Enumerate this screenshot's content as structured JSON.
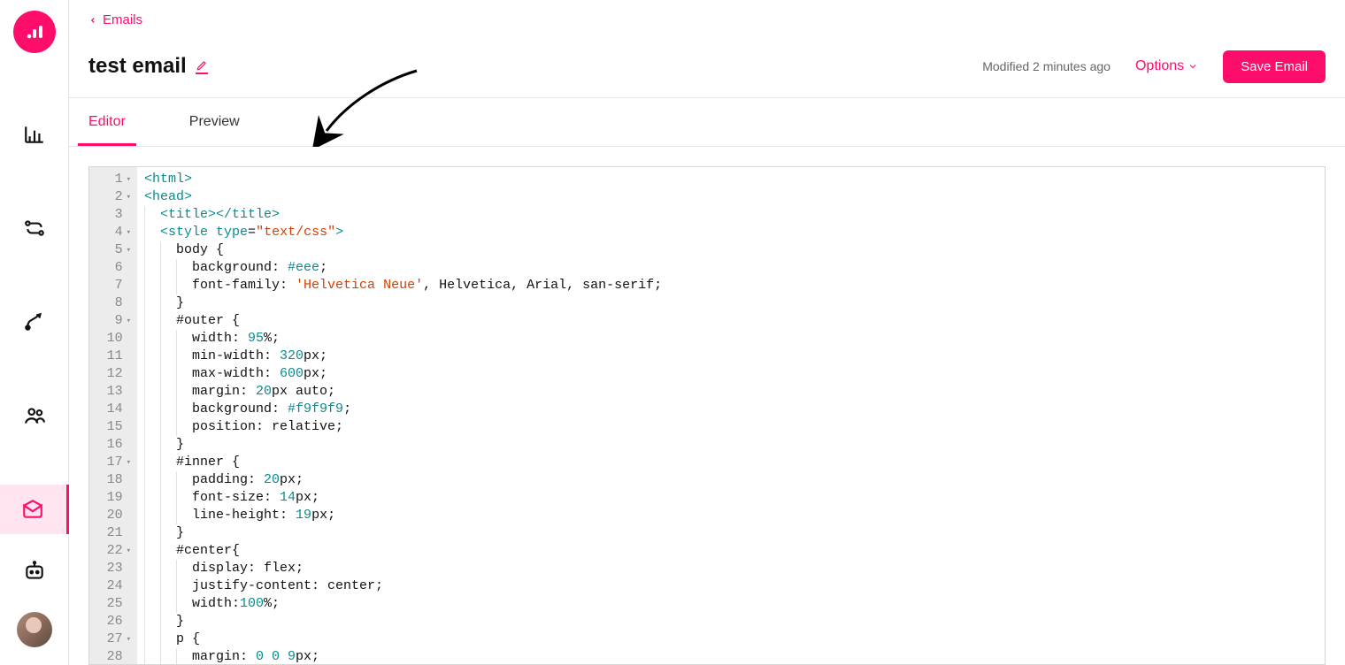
{
  "sidebar": {
    "nav_items": [
      {
        "name": "analytics",
        "icon": "bar-chart-icon"
      },
      {
        "name": "flows",
        "icon": "flow-icon"
      },
      {
        "name": "journeys",
        "icon": "journey-icon"
      },
      {
        "name": "people",
        "icon": "people-icon"
      },
      {
        "name": "emails",
        "icon": "envelope-icon",
        "active": true
      }
    ]
  },
  "header": {
    "back_label": "Emails",
    "title": "test email",
    "modified_text": "Modified 2 minutes ago",
    "options_label": "Options",
    "save_label": "Save Email"
  },
  "tabs": {
    "editor_label": "Editor",
    "preview_label": "Preview"
  },
  "editor": {
    "lines": [
      {
        "n": 1,
        "fold": true,
        "html": "<span class='tag'>&lt;html&gt;</span>"
      },
      {
        "n": 2,
        "fold": true,
        "html": "<span class='tag'>&lt;head&gt;</span>"
      },
      {
        "n": 3,
        "fold": false,
        "html": "  <span class='tag'>&lt;title&gt;&lt;/title&gt;</span>"
      },
      {
        "n": 4,
        "fold": true,
        "html": "  <span class='tag'>&lt;style</span> <span class='attr'>type</span>=<span class='str'>\"text/css\"</span><span class='tag'>&gt;</span>"
      },
      {
        "n": 5,
        "fold": true,
        "html": "    <span class='sel'>body</span> {"
      },
      {
        "n": 6,
        "fold": false,
        "html": "      <span class='prop'>background:</span> <span class='hex'>#eee</span>;"
      },
      {
        "n": 7,
        "fold": false,
        "html": "      <span class='prop'>font-family:</span> <span class='str'>'Helvetica Neue'</span>, Helvetica, Arial, san-serif;"
      },
      {
        "n": 8,
        "fold": false,
        "html": "    }"
      },
      {
        "n": 9,
        "fold": true,
        "html": "    <span class='sel'>#outer</span> {"
      },
      {
        "n": 10,
        "fold": false,
        "html": "      <span class='prop'>width:</span> <span class='num'>95</span>%;"
      },
      {
        "n": 11,
        "fold": false,
        "html": "      <span class='prop'>min-width:</span> <span class='num'>320</span>px;"
      },
      {
        "n": 12,
        "fold": false,
        "html": "      <span class='prop'>max-width:</span> <span class='num'>600</span>px;"
      },
      {
        "n": 13,
        "fold": false,
        "html": "      <span class='prop'>margin:</span> <span class='num'>20</span>px auto;"
      },
      {
        "n": 14,
        "fold": false,
        "html": "      <span class='prop'>background:</span> <span class='hex'>#f9f9f9</span>;"
      },
      {
        "n": 15,
        "fold": false,
        "html": "      <span class='prop'>position:</span> relative;"
      },
      {
        "n": 16,
        "fold": false,
        "html": "    }"
      },
      {
        "n": 17,
        "fold": true,
        "html": "    <span class='sel'>#inner</span> {"
      },
      {
        "n": 18,
        "fold": false,
        "html": "      <span class='prop'>padding:</span> <span class='num'>20</span>px;"
      },
      {
        "n": 19,
        "fold": false,
        "html": "      <span class='prop'>font-size:</span> <span class='num'>14</span>px;"
      },
      {
        "n": 20,
        "fold": false,
        "html": "      <span class='prop'>line-height:</span> <span class='num'>19</span>px;"
      },
      {
        "n": 21,
        "fold": false,
        "html": "    }"
      },
      {
        "n": 22,
        "fold": true,
        "html": "    <span class='sel'>#center</span>{"
      },
      {
        "n": 23,
        "fold": false,
        "html": "      <span class='prop'>display:</span> flex;"
      },
      {
        "n": 24,
        "fold": false,
        "html": "      <span class='prop'>justify-content:</span> center;"
      },
      {
        "n": 25,
        "fold": false,
        "html": "      <span class='prop'>width:</span><span class='num'>100</span>%;"
      },
      {
        "n": 26,
        "fold": false,
        "html": "    }"
      },
      {
        "n": 27,
        "fold": true,
        "html": "    <span class='sel'>p</span> {"
      },
      {
        "n": 28,
        "fold": false,
        "html": "      <span class='prop'>margin:</span> <span class='num'>0 0 9</span>px;"
      }
    ]
  }
}
